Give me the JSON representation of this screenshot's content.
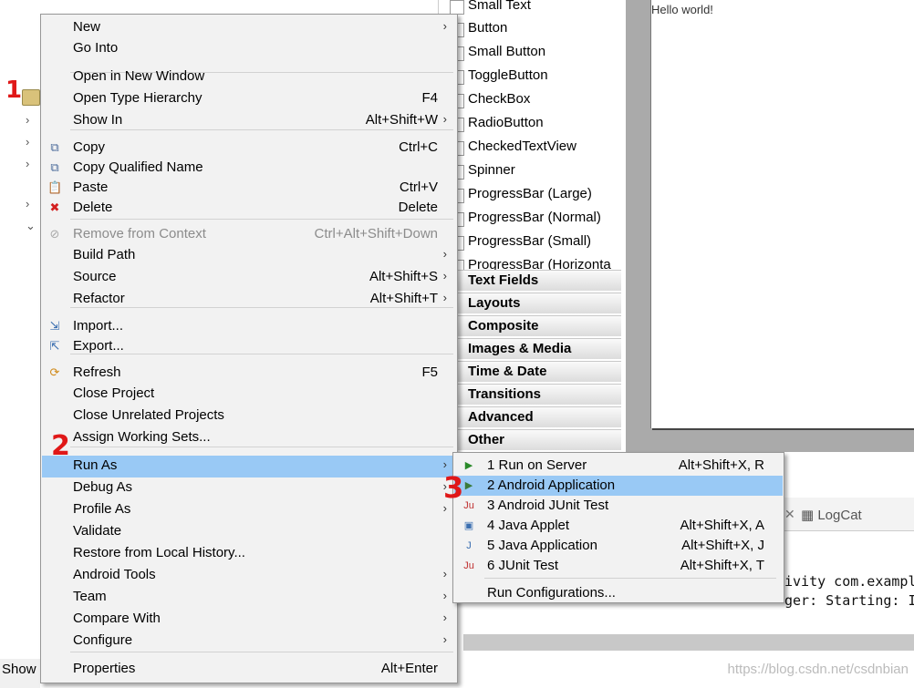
{
  "background": {
    "explorer_bottom_label": "Show",
    "palette_items": [
      "Small Text",
      "Button",
      "Small Button",
      "ToggleButton",
      "CheckBox",
      "RadioButton",
      "CheckedTextView",
      "Spinner",
      "ProgressBar (Large)",
      "ProgressBar (Normal)",
      "ProgressBar (Small)",
      "ProgressBar (Horizonta"
    ],
    "palette_categories": [
      "Text Fields",
      "Layouts",
      "Composite",
      "Images & Media",
      "Time & Date",
      "Transitions",
      "Advanced",
      "Other"
    ],
    "canvas_text": "Hello world!",
    "console_tab": "LogCat",
    "console_lines": [
      "ivity com.exampl",
      "ger: Starting: I"
    ],
    "watermark": "https://blog.csdn.net/csdnbian"
  },
  "annotations": [
    "1",
    "2",
    "3"
  ],
  "context_menu": {
    "items": [
      {
        "label": "New",
        "shortcut": "",
        "submenu": true,
        "icon": ""
      },
      {
        "label": "Go Into",
        "shortcut": "",
        "submenu": false,
        "icon": ""
      },
      {
        "label": "Open in New Window",
        "shortcut": "",
        "submenu": false,
        "icon": ""
      },
      {
        "label": "Open Type Hierarchy",
        "shortcut": "F4",
        "submenu": false,
        "icon": ""
      },
      {
        "label": "Show In",
        "shortcut": "Alt+Shift+W",
        "submenu": true,
        "icon": ""
      },
      {
        "label": "Copy",
        "shortcut": "Ctrl+C",
        "submenu": false,
        "icon": "copy-icon"
      },
      {
        "label": "Copy Qualified Name",
        "shortcut": "",
        "submenu": false,
        "icon": "copy-qualified-icon"
      },
      {
        "label": "Paste",
        "shortcut": "Ctrl+V",
        "submenu": false,
        "icon": "paste-icon"
      },
      {
        "label": "Delete",
        "shortcut": "Delete",
        "submenu": false,
        "icon": "delete-icon"
      },
      {
        "label": "Remove from Context",
        "shortcut": "Ctrl+Alt+Shift+Down",
        "submenu": false,
        "icon": "remove-context-icon",
        "disabled": true
      },
      {
        "label": "Build Path",
        "shortcut": "",
        "submenu": true,
        "icon": ""
      },
      {
        "label": "Source",
        "shortcut": "Alt+Shift+S",
        "submenu": true,
        "icon": ""
      },
      {
        "label": "Refactor",
        "shortcut": "Alt+Shift+T",
        "submenu": true,
        "icon": ""
      },
      {
        "label": "Import...",
        "shortcut": "",
        "submenu": false,
        "icon": "import-icon"
      },
      {
        "label": "Export...",
        "shortcut": "",
        "submenu": false,
        "icon": "export-icon"
      },
      {
        "label": "Refresh",
        "shortcut": "F5",
        "submenu": false,
        "icon": "refresh-icon"
      },
      {
        "label": "Close Project",
        "shortcut": "",
        "submenu": false,
        "icon": ""
      },
      {
        "label": "Close Unrelated Projects",
        "shortcut": "",
        "submenu": false,
        "icon": ""
      },
      {
        "label": "Assign Working Sets...",
        "shortcut": "",
        "submenu": false,
        "icon": ""
      },
      {
        "label": "Run As",
        "shortcut": "",
        "submenu": true,
        "icon": "",
        "highlighted": true
      },
      {
        "label": "Debug As",
        "shortcut": "",
        "submenu": true,
        "icon": ""
      },
      {
        "label": "Profile As",
        "shortcut": "",
        "submenu": true,
        "icon": ""
      },
      {
        "label": "Validate",
        "shortcut": "",
        "submenu": false,
        "icon": ""
      },
      {
        "label": "Restore from Local History...",
        "shortcut": "",
        "submenu": false,
        "icon": ""
      },
      {
        "label": "Android Tools",
        "shortcut": "",
        "submenu": true,
        "icon": ""
      },
      {
        "label": "Team",
        "shortcut": "",
        "submenu": true,
        "icon": ""
      },
      {
        "label": "Compare With",
        "shortcut": "",
        "submenu": true,
        "icon": ""
      },
      {
        "label": "Configure",
        "shortcut": "",
        "submenu": true,
        "icon": ""
      },
      {
        "label": "Properties",
        "shortcut": "Alt+Enter",
        "submenu": false,
        "icon": ""
      }
    ]
  },
  "run_as_submenu": {
    "items": [
      {
        "label": "1 Run on Server",
        "shortcut": "Alt+Shift+X, R",
        "icon": "server-run-icon"
      },
      {
        "label": "2 Android Application",
        "shortcut": "",
        "icon": "android-app-icon",
        "highlighted": true
      },
      {
        "label": "3 Android JUnit Test",
        "shortcut": "",
        "icon": "android-junit-icon"
      },
      {
        "label": "4 Java Applet",
        "shortcut": "Alt+Shift+X, A",
        "icon": "java-applet-icon"
      },
      {
        "label": "5 Java Application",
        "shortcut": "Alt+Shift+X, J",
        "icon": "java-app-icon"
      },
      {
        "label": "6 JUnit Test",
        "shortcut": "Alt+Shift+X, T",
        "icon": "junit-icon"
      },
      {
        "label": "Run Configurations...",
        "shortcut": "",
        "icon": ""
      }
    ]
  },
  "colors": {
    "highlight": "#99c9f5",
    "annotation": "#e01818",
    "menu_bg": "#f2f2f2"
  }
}
